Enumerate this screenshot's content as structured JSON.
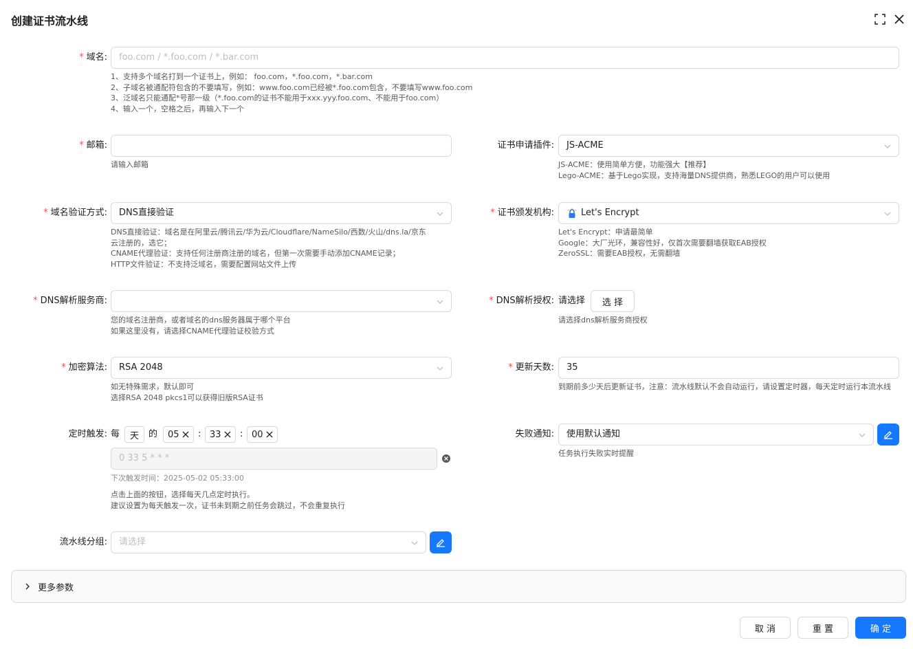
{
  "header": {
    "title": "创建证书流水线"
  },
  "domain": {
    "label": "域名:",
    "placeholder": "foo.com / *.foo.com / *.bar.com",
    "help": [
      "1、支持多个域名打到一个证书上，例如： foo.com，*.foo.com，*.bar.com",
      "2、子域名被通配符包含的不要填写，例如：www.foo.com已经被*.foo.com包含，不要填写www.foo.com",
      "3、泛域名只能通配*号那一级（*.foo.com的证书不能用于xxx.yyy.foo.com、不能用于foo.com）",
      "4、输入一个，空格之后，再输入下一个"
    ]
  },
  "email": {
    "label": "邮箱:",
    "value": "",
    "help": [
      "请输入邮箱"
    ]
  },
  "plugin": {
    "label": "证书申请插件:",
    "value": "JS-ACME",
    "help": [
      "JS-ACME：使用简单方便，功能强大【推荐】",
      "Lego-ACME：基于Lego实现，支持海量DNS提供商，熟悉LEGO的用户可以使用"
    ]
  },
  "verify": {
    "label": "域名验证方式:",
    "value": "DNS直接验证",
    "help": [
      "DNS直接验证：域名是在阿里云/腾讯云/华为云/Cloudflare/NameSilo/西数/火山/dns.la/京东",
      "云注册的，选它；",
      "CNAME代理验证：支持任何注册商注册的域名，但第一次需要手动添加CNAME记录；",
      "HTTP文件验证：不支持泛域名，需要配置网站文件上传"
    ]
  },
  "ca": {
    "label": "证书颁发机构:",
    "value": "Let's Encrypt",
    "help": [
      "Let's Encrypt：申请最简单",
      "Google：大厂光环，兼容性好，仅首次需要翻墙获取EAB授权",
      "ZeroSSL：需要EAB授权，无需翻墙"
    ]
  },
  "dns_provider": {
    "label": "DNS解析服务商:",
    "value": "",
    "help": [
      "您的域名注册商，或者域名的dns服务器属于哪个平台",
      "如果这里没有，请选择CNAME代理验证校验方式"
    ]
  },
  "dns_auth": {
    "label": "DNS解析授权:",
    "value": "请选择",
    "button": "选 择",
    "help": [
      "请选择dns解析服务商授权"
    ]
  },
  "algo": {
    "label": "加密算法:",
    "value": "RSA 2048",
    "help": [
      "如无特殊需求，默认即可",
      "选择RSA 2048 pkcs1可以获得旧版RSA证书"
    ]
  },
  "renew": {
    "label": "更新天数:",
    "value": "35",
    "help": "到期前多少天后更新证书，注意：流水线默认不会自动运行，请设置定时器，每天定时运行本流水线"
  },
  "schedule": {
    "label": "定时触发:",
    "every": "每",
    "unit": "天",
    "of": "的",
    "hour": "05",
    "minute": "33",
    "second": "00",
    "sep": ":",
    "cron": "0 33 5 * * *",
    "next_trigger": "下次触发时间：2025-05-02 05:33:00",
    "help": [
      "点击上面的按钮，选择每天几点定时执行。",
      "建议设置为每天触发一次，证书未到期之前任务会跳过，不会重复执行"
    ]
  },
  "notify": {
    "label": "失败通知:",
    "value": "使用默认通知",
    "help": [
      "任务执行失败实时提醒"
    ]
  },
  "group": {
    "label": "流水线分组:",
    "placeholder": "请选择"
  },
  "more": {
    "label": "更多参数"
  },
  "footer": {
    "cancel": "取 消",
    "reset": "重 置",
    "confirm": "确 定"
  },
  "colors": {
    "primary": "#1677ff",
    "required": "#ff4d4f"
  }
}
